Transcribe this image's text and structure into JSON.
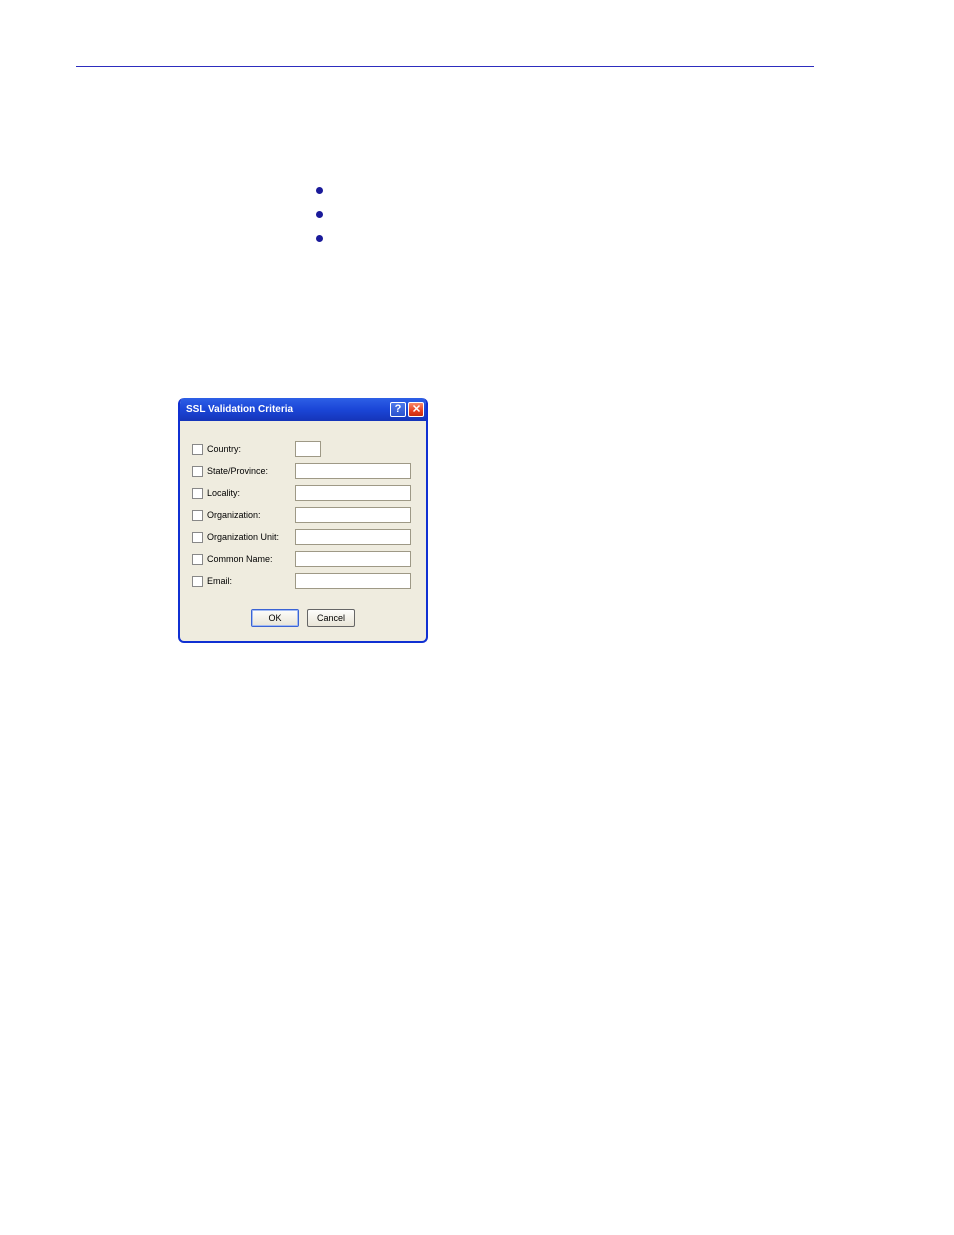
{
  "dialog": {
    "title": "SSL Validation Criteria",
    "fields": [
      {
        "label": "Country:",
        "width": "short"
      },
      {
        "label": "State/Province:",
        "width": "long"
      },
      {
        "label": "Locality:",
        "width": "long"
      },
      {
        "label": "Organization:",
        "width": "long"
      },
      {
        "label": "Organization Unit:",
        "width": "long"
      },
      {
        "label": "Common Name:",
        "width": "long"
      },
      {
        "label": "Email:",
        "width": "long"
      }
    ],
    "buttons": {
      "ok": "OK",
      "cancel": "Cancel"
    }
  }
}
